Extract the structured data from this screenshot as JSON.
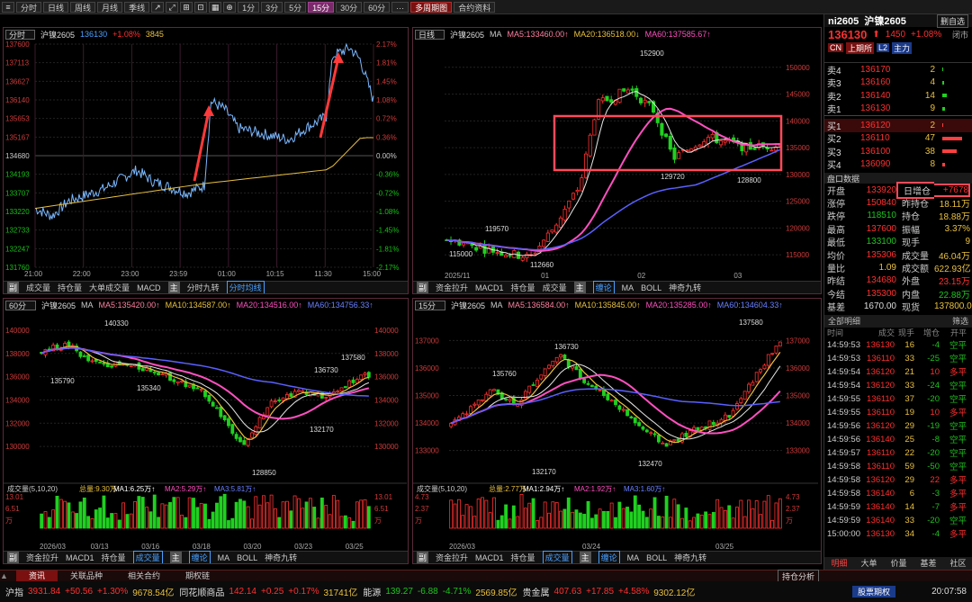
{
  "toolbar": {
    "items": [
      "分时",
      "日线",
      "周线",
      "月线",
      "季线",
      "1分",
      "3分",
      "5分",
      "15分",
      "30分",
      "60分",
      "···"
    ],
    "multi": "多周期图",
    "contract_info": "合约资料"
  },
  "header": {
    "symbol": "ni2605",
    "name": "沪镍2605",
    "self_select": "删自选",
    "price": "136130",
    "arrow": "⬆",
    "change": "1450",
    "pct": "+1.08%",
    "closed": "闭市",
    "tags": [
      "CN",
      "上期所",
      "L2",
      "主力"
    ]
  },
  "orderbook": {
    "asks": [
      {
        "label": "卖4",
        "price": "136170",
        "vol": "2"
      },
      {
        "label": "卖3",
        "price": "136160",
        "vol": "4"
      },
      {
        "label": "卖2",
        "price": "136140",
        "vol": "14"
      },
      {
        "label": "卖1",
        "price": "136130",
        "vol": "9"
      }
    ],
    "bids": [
      {
        "label": "买1",
        "price": "136120",
        "vol": "2"
      },
      {
        "label": "买2",
        "price": "136110",
        "vol": "47"
      },
      {
        "label": "买3",
        "price": "136100",
        "vol": "38"
      },
      {
        "label": "买4",
        "price": "136090",
        "vol": "8"
      }
    ]
  },
  "stats": {
    "title": "盘口数据",
    "rows": [
      [
        "开盘",
        "133920",
        "日增仓",
        "+7678"
      ],
      [
        "涨停",
        "150840",
        "昨持仓",
        "18.11万"
      ],
      [
        "跌停",
        "118510",
        "持仓",
        "18.88万"
      ],
      [
        "最高",
        "137600",
        "振幅",
        "3.37%"
      ],
      [
        "最低",
        "133100",
        "现手",
        "9"
      ],
      [
        "均价",
        "135306",
        "成交量",
        "46.04万"
      ],
      [
        "量比",
        "1.09",
        "成交额",
        "622.93亿"
      ],
      [
        "昨结",
        "134680",
        "外盘",
        "23.15万"
      ],
      [
        "今结",
        "135300",
        "内盘",
        "22.88万"
      ],
      [
        "基差",
        "1670.00",
        "现货",
        "137800.00"
      ]
    ]
  },
  "ticks": {
    "title": "全部明细",
    "filter": "筛选",
    "headers": [
      "时间",
      "成交",
      "现手",
      "增仓",
      "开平"
    ],
    "rows": [
      [
        "14:59:53",
        "136130",
        "16",
        "-4",
        "空平"
      ],
      [
        "14:59:53",
        "136110",
        "33",
        "-25",
        "空平"
      ],
      [
        "14:59:54",
        "136120",
        "21",
        "10",
        "多平"
      ],
      [
        "14:59:54",
        "136120",
        "33",
        "-24",
        "空平"
      ],
      [
        "14:59:55",
        "136110",
        "37",
        "-20",
        "空平"
      ],
      [
        "14:59:55",
        "136110",
        "19",
        "10",
        "多平"
      ],
      [
        "14:59:56",
        "136120",
        "29",
        "-19",
        "空平"
      ],
      [
        "14:59:56",
        "136140",
        "25",
        "-8",
        "空平"
      ],
      [
        "14:59:57",
        "136110",
        "22",
        "-20",
        "空平"
      ],
      [
        "14:59:58",
        "136110",
        "59",
        "-50",
        "空平"
      ],
      [
        "14:59:58",
        "136120",
        "29",
        "22",
        "多平"
      ],
      [
        "14:59:58",
        "136140",
        "6",
        "-3",
        "多平"
      ],
      [
        "14:59:59",
        "136140",
        "14",
        "-7",
        "多平"
      ],
      [
        "14:59:59",
        "136140",
        "33",
        "-20",
        "空平"
      ],
      [
        "15:00:00",
        "136130",
        "34",
        "-4",
        "多平"
      ]
    ],
    "tabs": [
      "明细",
      "大单",
      "价量",
      "基差",
      "社区"
    ]
  },
  "intraday": {
    "period": "分时",
    "symbol": "沪镍2605",
    "price": "136130",
    "pct": "+1.08%",
    "vol": "3845",
    "yaxis": [
      "137600",
      "137113",
      "136627",
      "136140",
      "135653",
      "135167",
      "134680",
      "134193",
      "133707",
      "133220",
      "132733",
      "132247",
      "131760"
    ],
    "pct_axis": [
      "2.17%",
      "1.81%",
      "1.45%",
      "1.08%",
      "0.72%",
      "0.36%",
      "0.00%",
      "-0.36%",
      "-0.72%",
      "-1.08%",
      "-1.45%",
      "-1.81%",
      "-2.17%"
    ],
    "times": [
      "21:00",
      "22:00",
      "23:00",
      "23:59",
      "01:00",
      "10:15",
      "11:30",
      "15:00"
    ],
    "tabs": [
      "副",
      "成交量",
      "持仓量",
      "大单成交量",
      "MACD",
      "主",
      "分时九转",
      "分时均线"
    ]
  },
  "daily": {
    "period": "日线",
    "symbol": "沪镍2605",
    "ma": [
      "MA",
      "MA5:133460.00↑",
      "MA20:136518.00↓",
      "MA60:137585.67↑"
    ],
    "yaxis": [
      "150000",
      "145000",
      "140000",
      "135000",
      "130000",
      "125000",
      "120000",
      "115000"
    ],
    "xaxis": [
      "2025/11",
      "01",
      "02",
      "03"
    ],
    "labels": [
      "152900",
      "129720",
      "128800",
      "119570",
      "112660"
    ],
    "tabs": [
      "副",
      "资金拉升",
      "MACD1",
      "持仓量",
      "成交量",
      "主",
      "缠论",
      "MA",
      "BOLL",
      "神奇九转"
    ]
  },
  "m60": {
    "period": "60分",
    "symbol": "沪镍2605",
    "ma": [
      "MA",
      "MA5:135420.00↑",
      "MA10:134587.00↑",
      "MA20:134516.00↑",
      "MA60:134756.33↑"
    ],
    "yaxis": [
      "140000",
      "138000",
      "136000",
      "134000",
      "132000",
      "130000"
    ],
    "xaxis": [
      "2026/03",
      "03/13",
      "03/16",
      "03/18",
      "03/20",
      "03/23",
      "03/25"
    ],
    "labels": [
      "140330",
      "135790",
      "135340",
      "136730",
      "137580",
      "132170",
      "128850"
    ],
    "vol_ma": [
      "成交量(5,10,20)",
      "总量:9.30万↑",
      "MA1:6.25万↑",
      "MA2:5.29万↑",
      "MA3:5.81万↑"
    ],
    "vol_axis": [
      "13.01",
      "6.51",
      "万"
    ],
    "tabs": [
      "副",
      "资金拉升",
      "MACD1",
      "持仓量",
      "成交量",
      "主",
      "缠论",
      "MA",
      "BOLL",
      "神奇九转"
    ]
  },
  "m15": {
    "period": "15分",
    "symbol": "沪镍2605",
    "ma": [
      "MA",
      "MA5:136584.00↑",
      "MA10:135845.00↑",
      "MA20:135285.00↑",
      "MA60:134604.33↑"
    ],
    "yaxis": [
      "137000",
      "136000",
      "135000",
      "134000",
      "133000"
    ],
    "xaxis": [
      "2026/03",
      "03/24",
      "03/25"
    ],
    "labels": [
      "136730",
      "135760",
      "137580",
      "132470",
      "132170"
    ],
    "vol_ma": [
      "成交量(5,10,20)",
      "总量:2.77万↑",
      "MA1:2.94万↑",
      "MA2:1.92万↑",
      "MA3:1.60万↑"
    ],
    "vol_axis": [
      "4.73",
      "2.37",
      "万"
    ],
    "tabs": [
      "副",
      "资金拉升",
      "MACD1",
      "持仓量",
      "成交量",
      "主",
      "缠论",
      "MA",
      "BOLL",
      "神奇九转"
    ]
  },
  "bottom_tabs": [
    "资讯",
    "关联品种",
    "相关合约",
    "期权链"
  ],
  "holdings_btn": "持仓分析",
  "market": [
    [
      "沪指",
      "3931.84",
      "+50.56",
      "+1.30%",
      "9678.54亿"
    ],
    [
      "同花顺商品",
      "142.14",
      "+0.25",
      "+0.17%",
      "31741亿"
    ],
    [
      "能源",
      "139.27",
      "-6.88",
      "-4.71%",
      "2569.85亿"
    ],
    [
      "贵金属",
      "407.63",
      "+17.85",
      "+4.58%",
      "9302.12亿"
    ]
  ],
  "clock": "20:07:58",
  "stock_tab": "股票期权"
}
